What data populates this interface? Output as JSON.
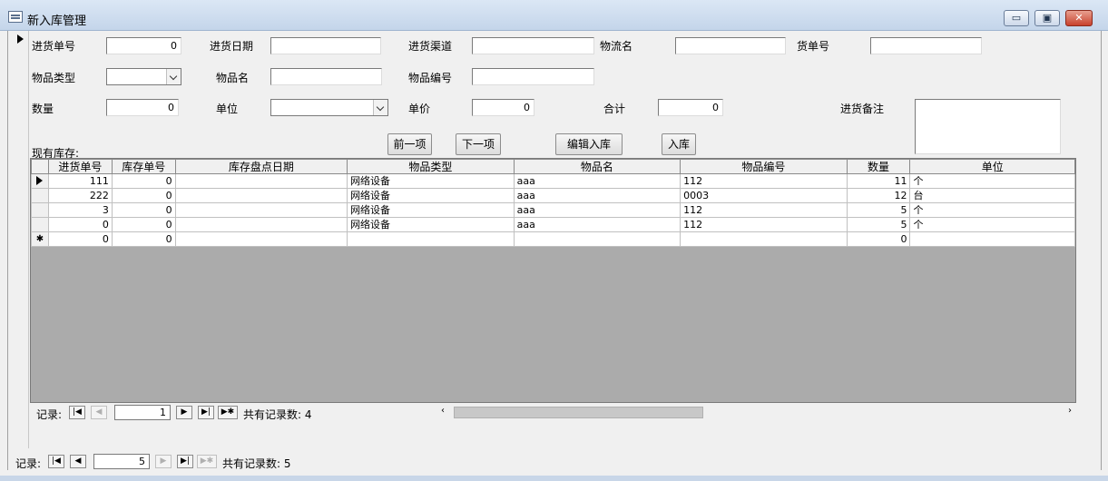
{
  "window": {
    "title": "新入库管理",
    "min": "▭",
    "max": "▣",
    "close": "✕"
  },
  "form": {
    "purchase_no_label": "进货单号",
    "purchase_no_value": "0",
    "purchase_date_label": "进货日期",
    "purchase_date_value": "",
    "channel_label": "进货渠道",
    "channel_value": "",
    "logistics_label": "物流名",
    "logistics_value": "",
    "waybill_label": "货单号",
    "waybill_value": "",
    "item_type_label": "物品类型",
    "item_type_value": "",
    "item_name_label": "物品名",
    "item_name_value": "",
    "item_code_label": "物品编号",
    "item_code_value": "",
    "qty_label": "数量",
    "qty_value": "0",
    "unit_label": "单位",
    "unit_value": "",
    "price_label": "单价",
    "price_value": "0",
    "total_label": "合计",
    "total_value": "0",
    "remark_label": "进货备注",
    "remark_value": "",
    "stock_label": "现有库存:"
  },
  "buttons": {
    "prev": "前一项",
    "next": "下一项",
    "edit": "编辑入库",
    "stock_in": "入库"
  },
  "grid": {
    "columns": [
      "进货单号",
      "库存单号",
      "库存盘点日期",
      "物品类型",
      "物品名",
      "物品编号",
      "数量",
      "单位"
    ],
    "rows": [
      [
        "111",
        "0",
        "",
        "网络设备",
        "aaa",
        "112",
        "11",
        "个"
      ],
      [
        "222",
        "0",
        "",
        "网络设备",
        "aaa",
        "0003",
        "12",
        "台"
      ],
      [
        "3",
        "0",
        "",
        "网络设备",
        "aaa",
        "112",
        "5",
        "个"
      ],
      [
        "0",
        "0",
        "",
        "网络设备",
        "aaa",
        "112",
        "5",
        "个"
      ]
    ],
    "new_row": [
      "0",
      "0",
      "",
      "",
      "",
      "",
      "0",
      ""
    ],
    "new_row_marker": "✱"
  },
  "subnav": {
    "label": "记录:",
    "current": "1",
    "total_text": "共有记录数: 4"
  },
  "mainnav": {
    "label": "记录:",
    "current": "5",
    "total_text": "共有记录数: 5"
  }
}
